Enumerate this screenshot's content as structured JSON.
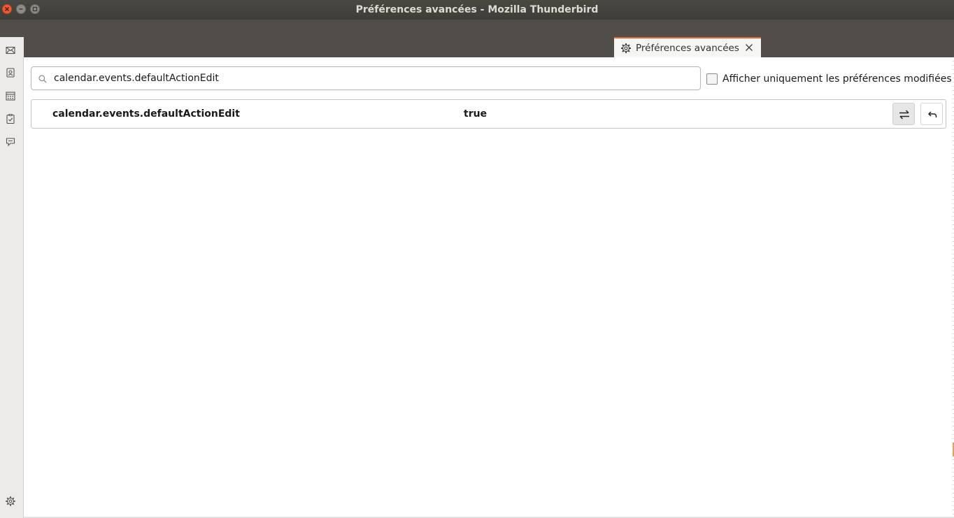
{
  "window": {
    "title": "Préférences avancées - Mozilla Thunderbird"
  },
  "tab": {
    "label": "Préférences avancées",
    "icon": "gear-icon"
  },
  "spaces": {
    "items": [
      "mail-icon",
      "address-book-icon",
      "calendar-icon",
      "tasks-icon",
      "chat-icon"
    ],
    "settings_icon": "gear-icon"
  },
  "search": {
    "value": "calendar.events.defaultActionEdit",
    "placeholder": ""
  },
  "filter": {
    "label": "Afficher uniquement les préférences modifiées",
    "checked": false
  },
  "prefs": [
    {
      "name": "calendar.events.defaultActionEdit",
      "value": "true"
    }
  ],
  "colors": {
    "tab_accent": "#e66a2c",
    "titlebar": "#3f3d38",
    "close_button": "#ef5a36"
  }
}
